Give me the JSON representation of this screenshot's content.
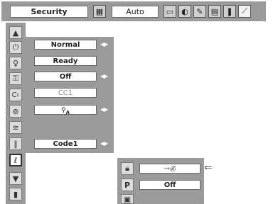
{
  "top_bar": {
    "label": "Security",
    "mode_value": "Auto",
    "icons": [
      "pc-adjust-icon",
      "image-select-icon",
      "image-adjust-icon",
      "screen-icon",
      "setting-icon",
      "sound-icon",
      "info-icon",
      "expand-icon"
    ]
  },
  "sidebar_icons": [
    "scroll-up-icon",
    "power-icon",
    "lamp-icon",
    "key-lock-icon",
    "closed-caption-icon",
    "eye-icon",
    "filter-icon",
    "pen-icon",
    "security-icon",
    "scroll-down-icon",
    "exit-icon"
  ],
  "settings": {
    "row1": "Normal",
    "row2": "Ready",
    "row3": "Off",
    "row4": "CC1",
    "row6": "Code1"
  },
  "security_submenu": {
    "pin_symbol": "⊸◎̸",
    "pin_value": "Off",
    "arrow_label": "⇐",
    "icons": [
      "lock-icon",
      "pin-p-icon",
      "logo-icon"
    ]
  }
}
